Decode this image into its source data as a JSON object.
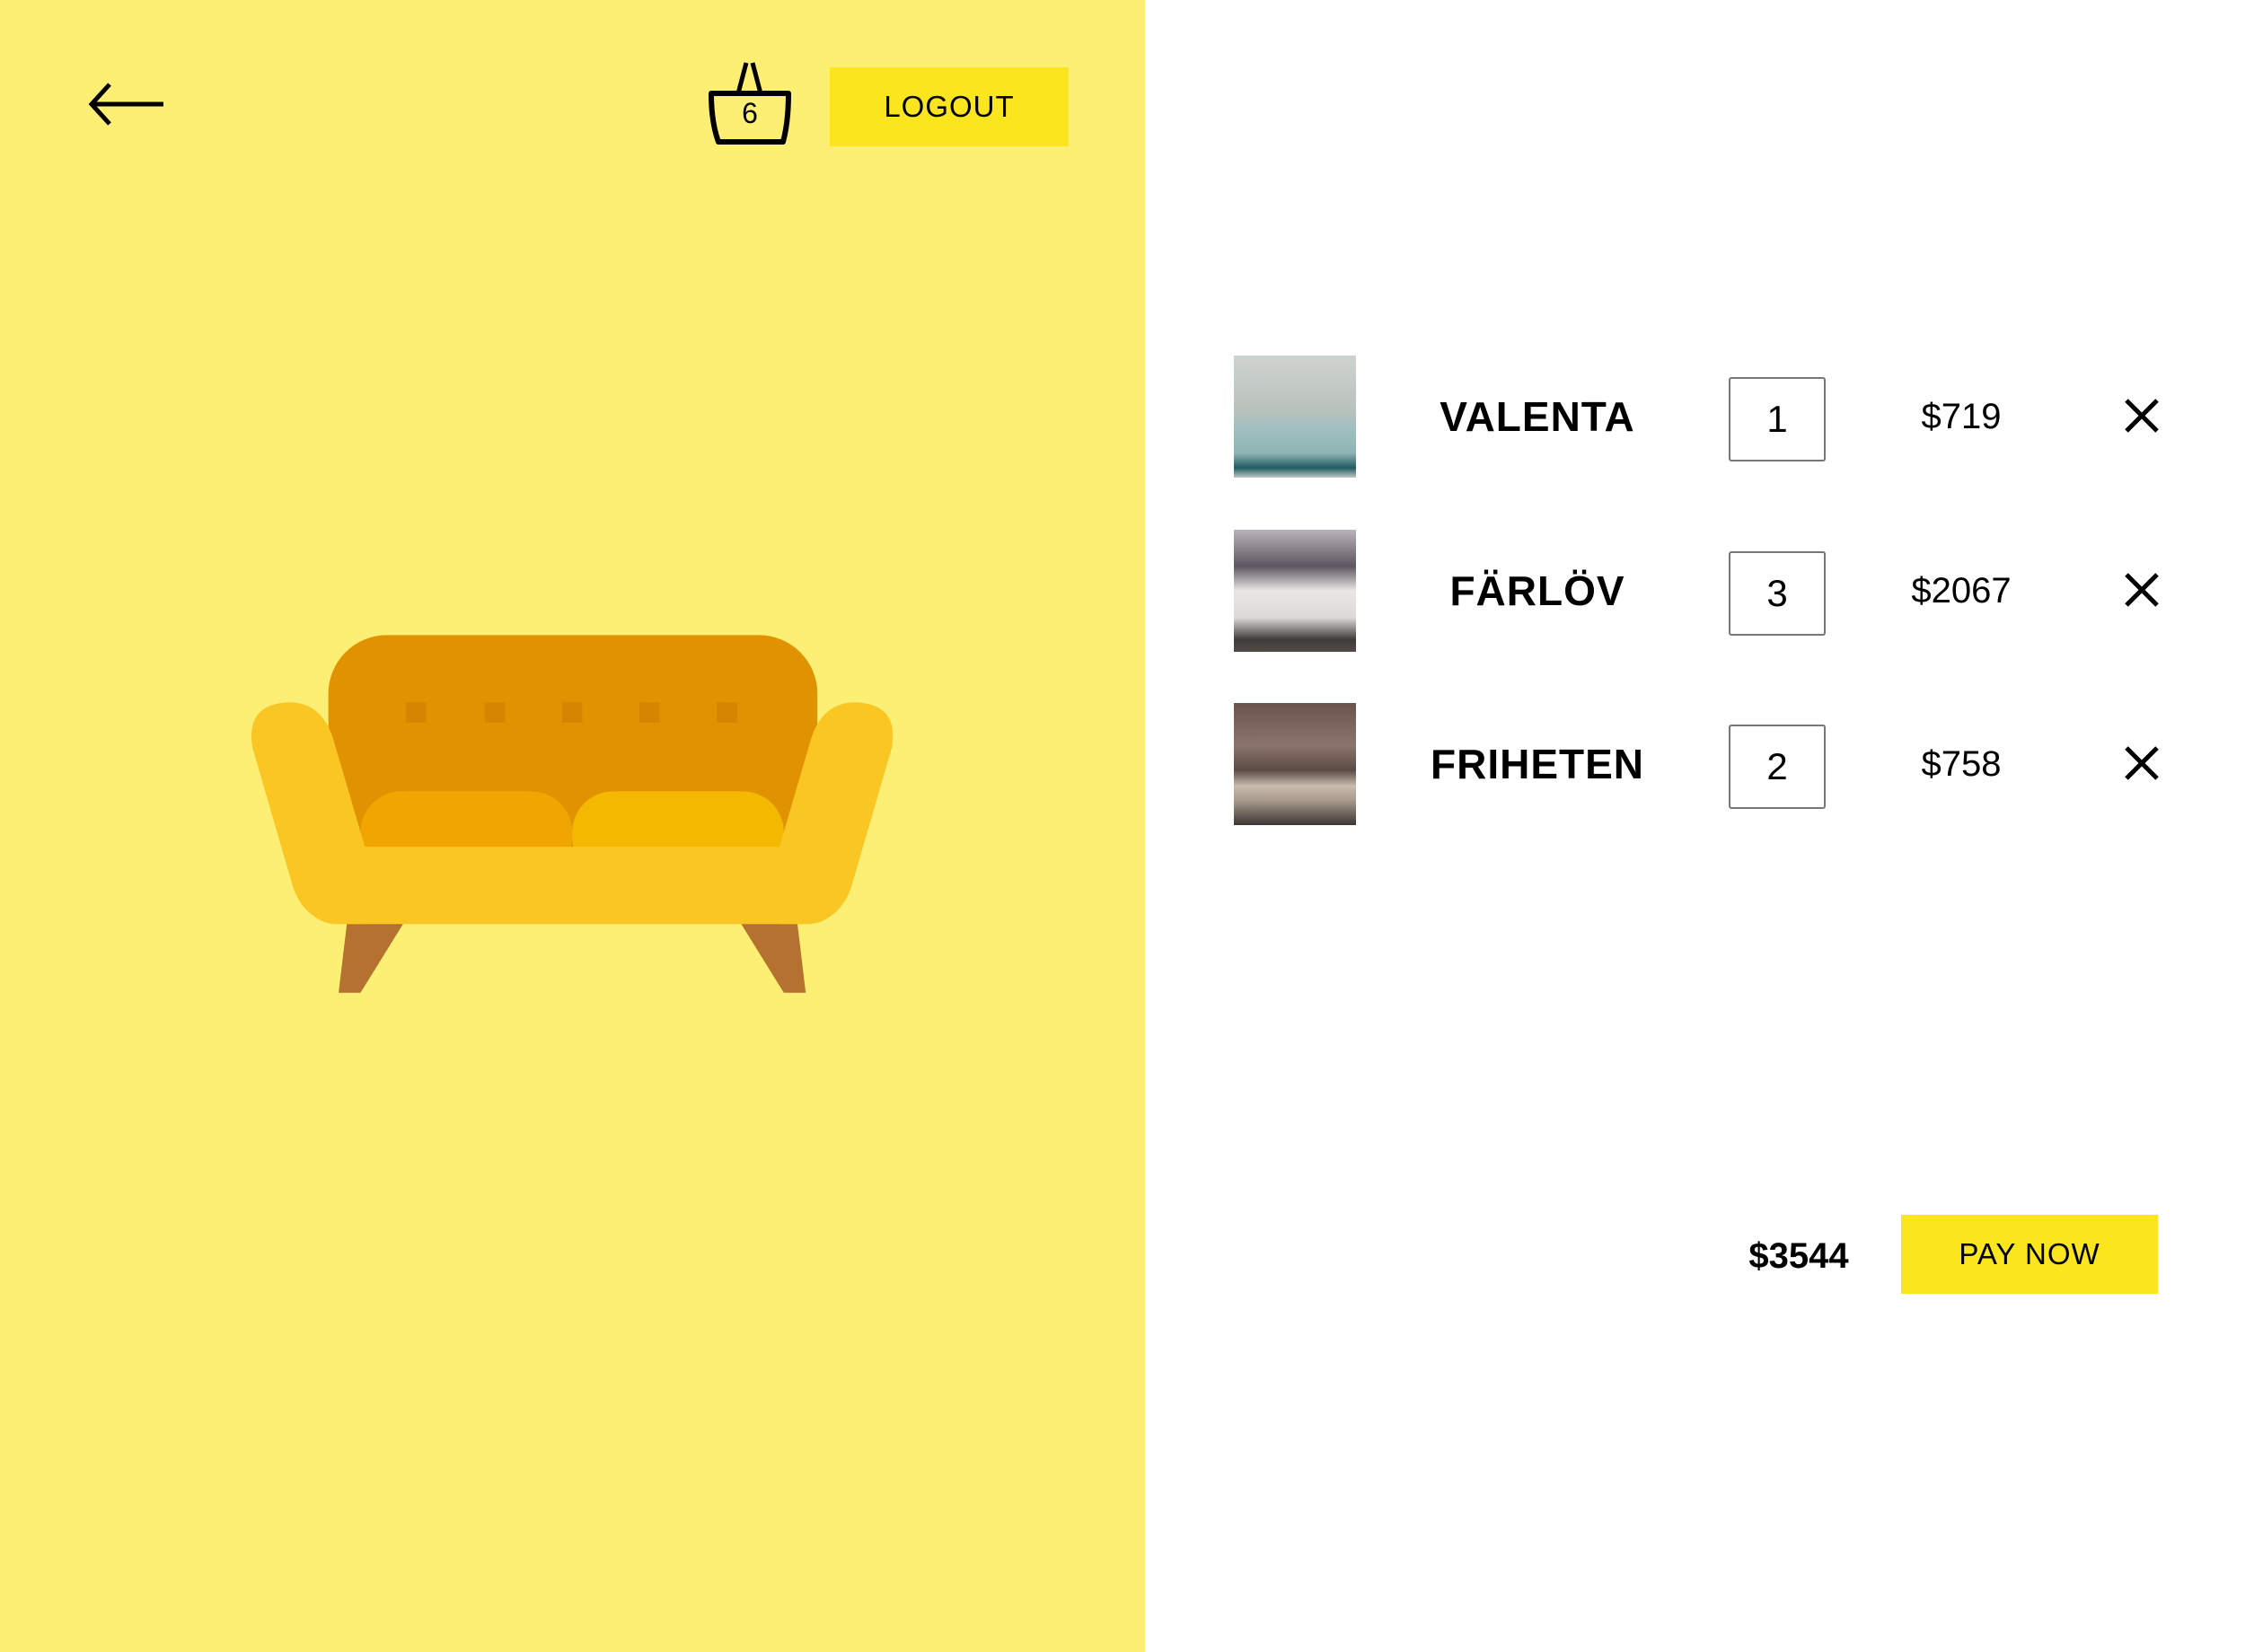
{
  "header": {
    "back_icon": "arrow-left-icon",
    "basket_icon": "basket-icon",
    "basket_count": "6",
    "logout_label": "LOGOUT"
  },
  "hero": {
    "illustration": "sofa"
  },
  "colors": {
    "panel": "#FDEF74",
    "accent": "#FBE51E"
  },
  "cart": {
    "items": [
      {
        "name": "VALENTA",
        "quantity": "1",
        "price": "$719"
      },
      {
        "name": "FÄRLÖV",
        "quantity": "3",
        "price": "$2067"
      },
      {
        "name": "FRIHETEN",
        "quantity": "2",
        "price": "$758"
      }
    ],
    "total": "$3544",
    "pay_label": "PAY NOW"
  }
}
